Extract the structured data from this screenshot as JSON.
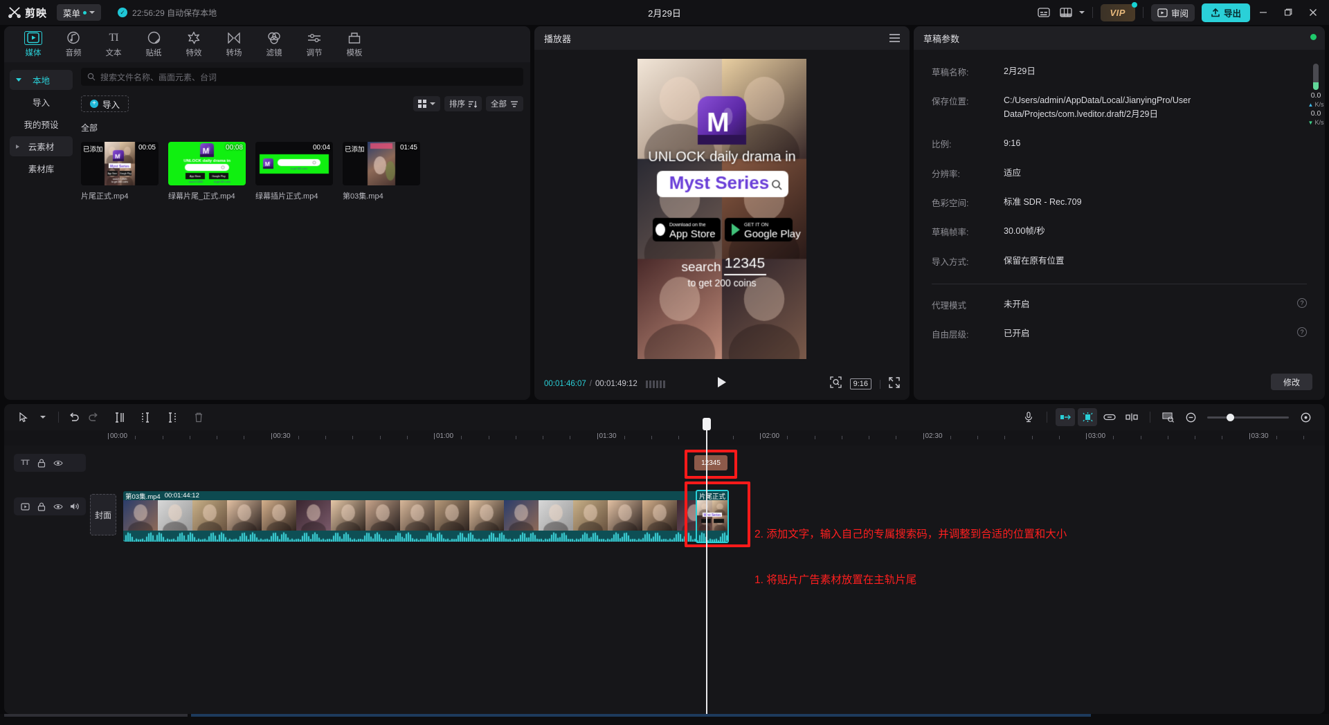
{
  "titlebar": {
    "app_name": "剪映",
    "menu_label": "菜单",
    "autosave": "22:56:29 自动保存本地",
    "project_title": "2月29日",
    "vip_label": "VIP",
    "review_label": "审阅",
    "export_label": "导出",
    "icons": [
      "subtitle-icon",
      "layout-icon",
      "minimize-icon",
      "maximize-icon",
      "close-icon"
    ]
  },
  "media": {
    "tabs": [
      {
        "label": "媒体",
        "icon": "media-icon",
        "active": true
      },
      {
        "label": "音频",
        "icon": "audio-icon",
        "active": false
      },
      {
        "label": "文本",
        "icon": "text-icon",
        "active": false
      },
      {
        "label": "贴纸",
        "icon": "sticker-icon",
        "active": false
      },
      {
        "label": "特效",
        "icon": "effects-icon",
        "active": false
      },
      {
        "label": "转场",
        "icon": "transition-icon",
        "active": false
      },
      {
        "label": "滤镜",
        "icon": "filter-icon",
        "active": false
      },
      {
        "label": "调节",
        "icon": "adjust-icon",
        "active": false
      },
      {
        "label": "模板",
        "icon": "template-icon",
        "active": false
      }
    ],
    "sidebar": [
      {
        "label": "本地",
        "selected": true,
        "group": true
      },
      {
        "label": "导入",
        "selected": false,
        "group": false
      },
      {
        "label": "我的预设",
        "selected": false,
        "group": false
      },
      {
        "label": "云素材",
        "selected": false,
        "group": true
      },
      {
        "label": "素材库",
        "selected": false,
        "group": false
      }
    ],
    "search_placeholder": "搜索文件名称、画面元素、台词",
    "import_label": "导入",
    "sort_label": "排序",
    "filter_label": "全部",
    "section_label": "全部",
    "items": [
      {
        "name": "片尾正式.mp4",
        "duration": "00:05",
        "added": "已添加",
        "kind": "endcard"
      },
      {
        "name": "绿幕片尾_正式.mp4",
        "duration": "00:08",
        "added": "",
        "kind": "green-endcard"
      },
      {
        "name": "绿幕插片正式.mp4",
        "duration": "00:04",
        "added": "",
        "kind": "green-insert"
      },
      {
        "name": "第03集.mp4",
        "duration": "01:45",
        "added": "已添加",
        "kind": "drama"
      }
    ]
  },
  "player": {
    "title": "播放器",
    "current_time": "00:01:46:07",
    "total_time": "00:01:49:12",
    "ratio_label": "9:16",
    "preview": {
      "headline": "UNLOCK daily drama in",
      "brand": "Myst Series",
      "appstore_small": "Download on the",
      "appstore_big": "App Store",
      "googleplay_small": "GET IT ON",
      "googleplay_big": "Google Play",
      "search_word": "search",
      "search_code": "12345",
      "coins_line": "to get 200 coins"
    }
  },
  "params": {
    "title": "草稿参数",
    "rows": [
      {
        "key": "草稿名称:",
        "value": "2月29日"
      },
      {
        "key": "保存位置:",
        "value": "C:/Users/admin/AppData/Local/JianyingPro/User Data/Projects/com.lveditor.draft/2月29日"
      },
      {
        "key": "比例:",
        "value": "9:16"
      },
      {
        "key": "分辨率:",
        "value": "适应"
      },
      {
        "key": "色彩空间:",
        "value": "标准 SDR - Rec.709"
      },
      {
        "key": "草稿帧率:",
        "value": "30.00帧/秒"
      },
      {
        "key": "导入方式:",
        "value": "保留在原有位置"
      }
    ],
    "toggles": [
      {
        "key": "代理模式",
        "value": "未开启"
      },
      {
        "key": "自由层级:",
        "value": "已开启"
      }
    ],
    "modify_label": "修改"
  },
  "netmeter": {
    "up_value": "0.0",
    "up_unit": "K/s",
    "down_value": "0.0",
    "down_unit": "K/s"
  },
  "timeline": {
    "tools_left": [
      "select-icon",
      "chevron-down-icon",
      "undo-icon",
      "redo-icon",
      "split-left-icon",
      "split-icon",
      "split-right-icon",
      "delete-icon"
    ],
    "tools_right": [
      "mic-icon",
      "snap-icon",
      "magnet-icon",
      "link-icon",
      "mirror-icon",
      "thumbnail-icon",
      "zoom-out-icon",
      "zoom-slider",
      "zoom-fit-icon"
    ],
    "ruler_labels": [
      "00:00",
      "00:30",
      "01:00",
      "01:30",
      "02:00",
      "02:30",
      "03:00",
      "03:30"
    ],
    "cover_label": "封面",
    "text_track_icons": [
      "text-icon",
      "lock-icon",
      "eye-icon",
      "mute-placeholder"
    ],
    "video_track_icons": [
      "video-icon",
      "lock-icon",
      "eye-icon",
      "volume-icon"
    ],
    "main_clip": {
      "name": "第03集.mp4",
      "duration": "00:01:44:12"
    },
    "tail_clip": {
      "name": "片尾正式"
    },
    "text_clip": {
      "label": "12345"
    },
    "annotations": [
      {
        "id": 2,
        "text": "2. 添加文字，输入自己的专属搜索码，并调整到合适的位置和大小"
      },
      {
        "id": 1,
        "text": "1. 将贴片广告素材放置在主轨片尾"
      }
    ]
  },
  "colors": {
    "accent": "#2ad0d8",
    "annotation": "#ff1f1f",
    "clip": "#0e4f55",
    "text_clip": "#8d5a4a",
    "vip": "#e8b97c"
  }
}
